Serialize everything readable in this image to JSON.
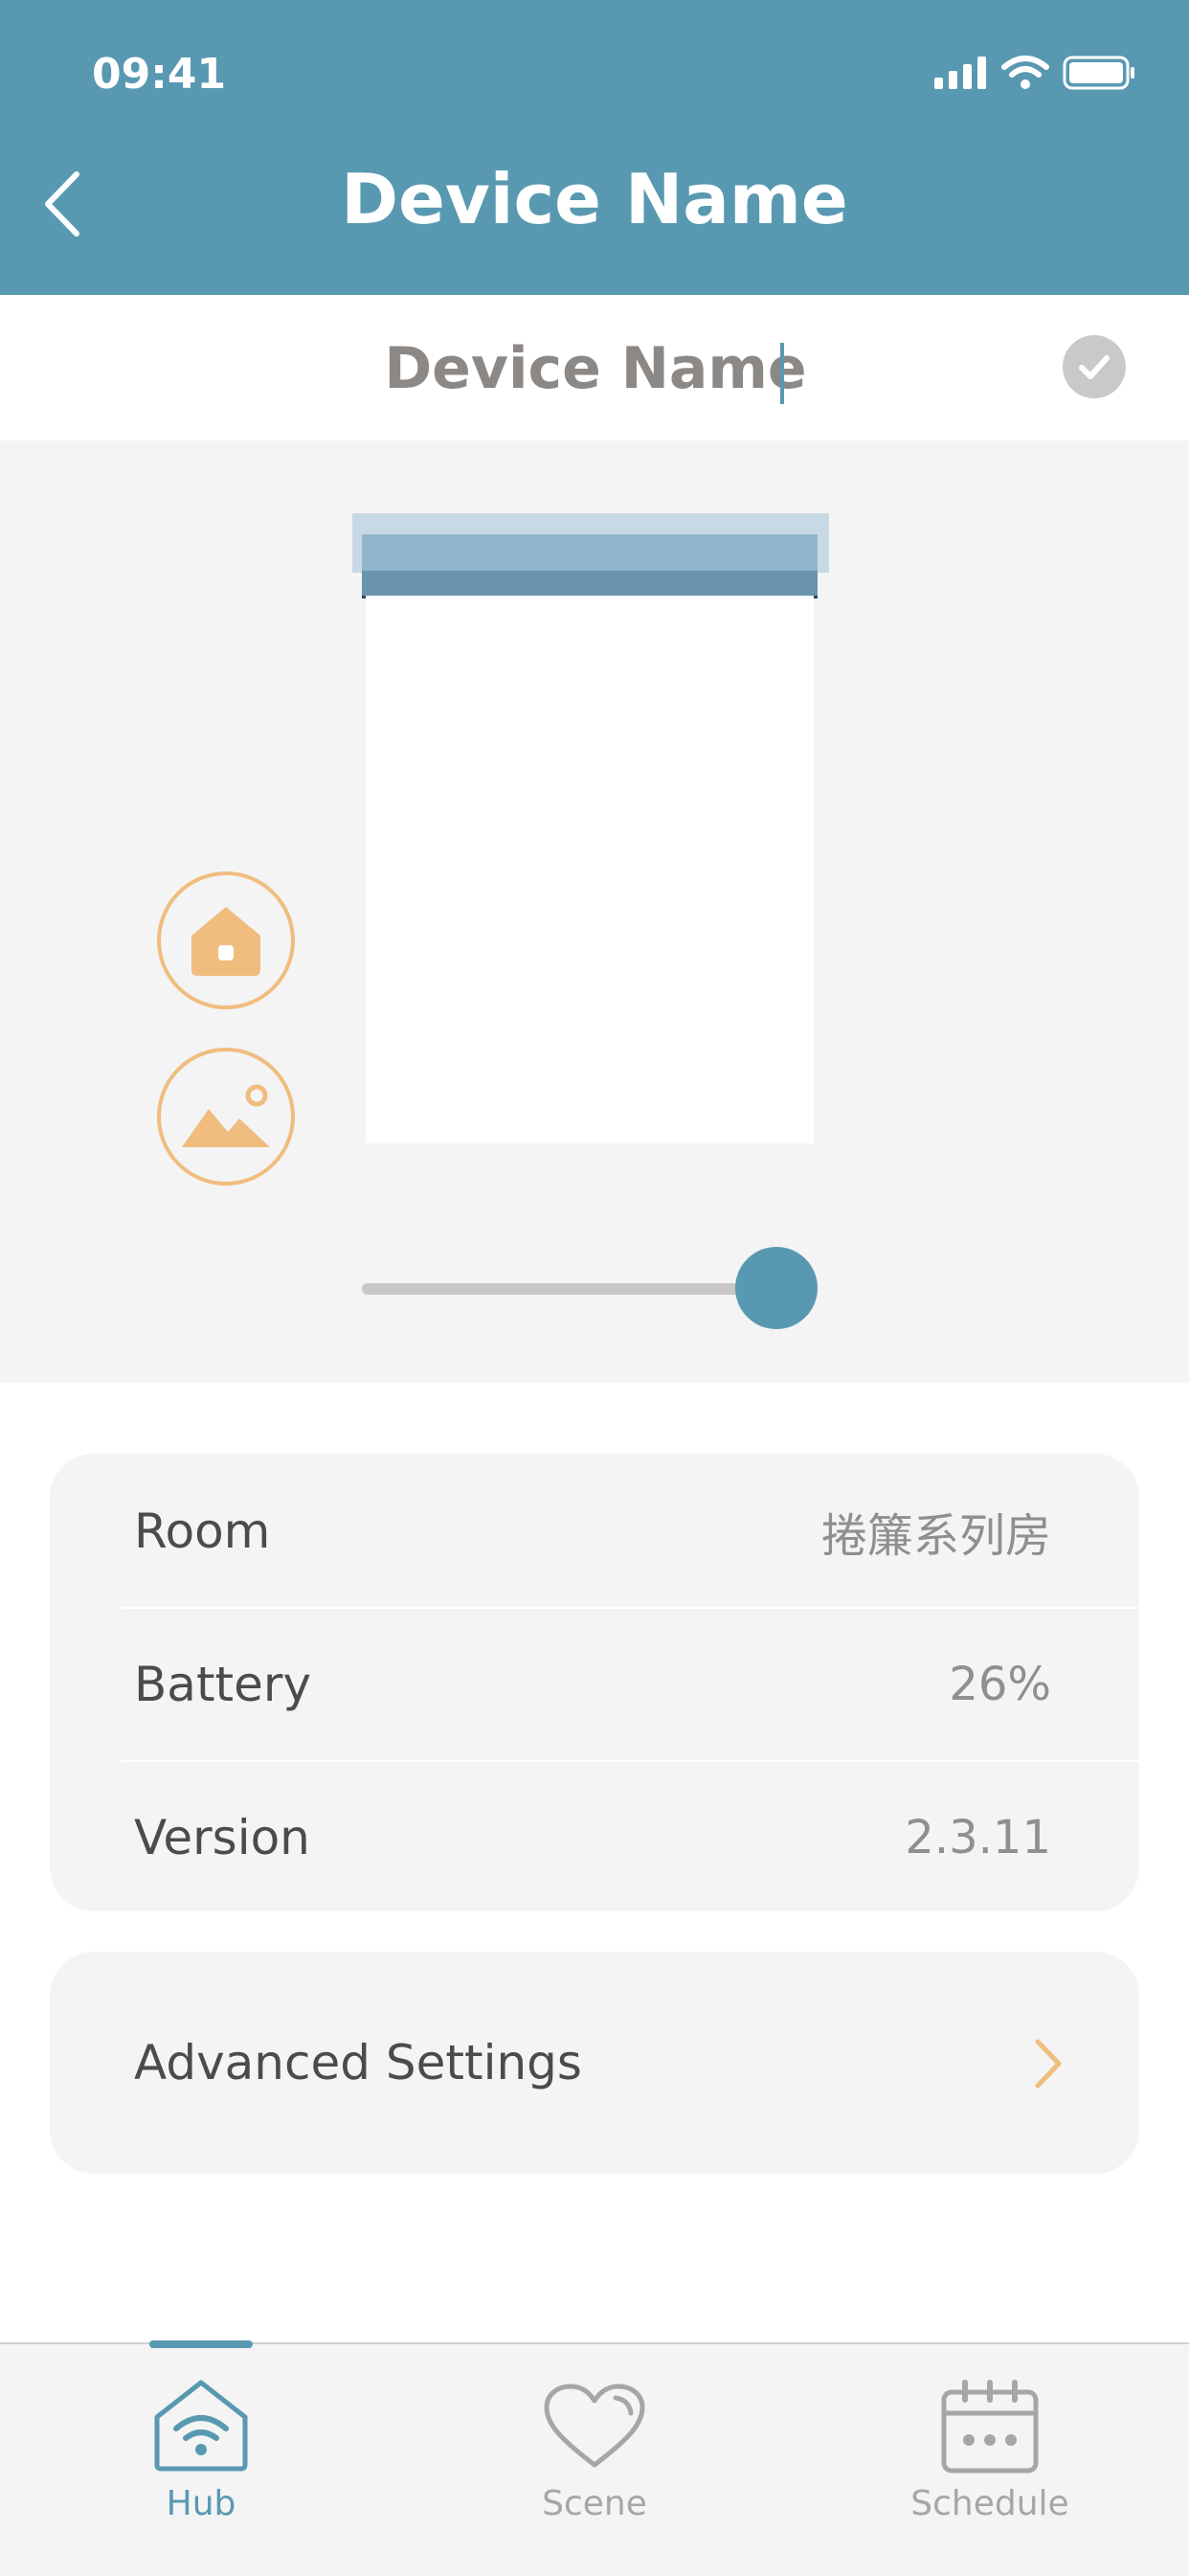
{
  "status_bar": {
    "time": "09:41"
  },
  "header": {
    "title": "Device Name"
  },
  "name_field": {
    "value": "Device Name"
  },
  "info_card": {
    "rows": [
      {
        "label": "Room",
        "value": "捲簾系列房"
      },
      {
        "label": "Battery",
        "value": "26%"
      },
      {
        "label": "Version",
        "value": "2.3.11"
      }
    ]
  },
  "advanced": {
    "label": "Advanced Settings"
  },
  "slider": {
    "position_fraction": 0.95
  },
  "tabs": [
    {
      "label": "Hub",
      "icon": "hub-wifi-icon",
      "active": true
    },
    {
      "label": "Scene",
      "icon": "heart-icon",
      "active": false
    },
    {
      "label": "Schedule",
      "icon": "calendar-icon",
      "active": false
    }
  ],
  "colors": {
    "primary": "#5899b1",
    "accent": "#f0bd7f",
    "inactive": "#a6a6a6"
  }
}
